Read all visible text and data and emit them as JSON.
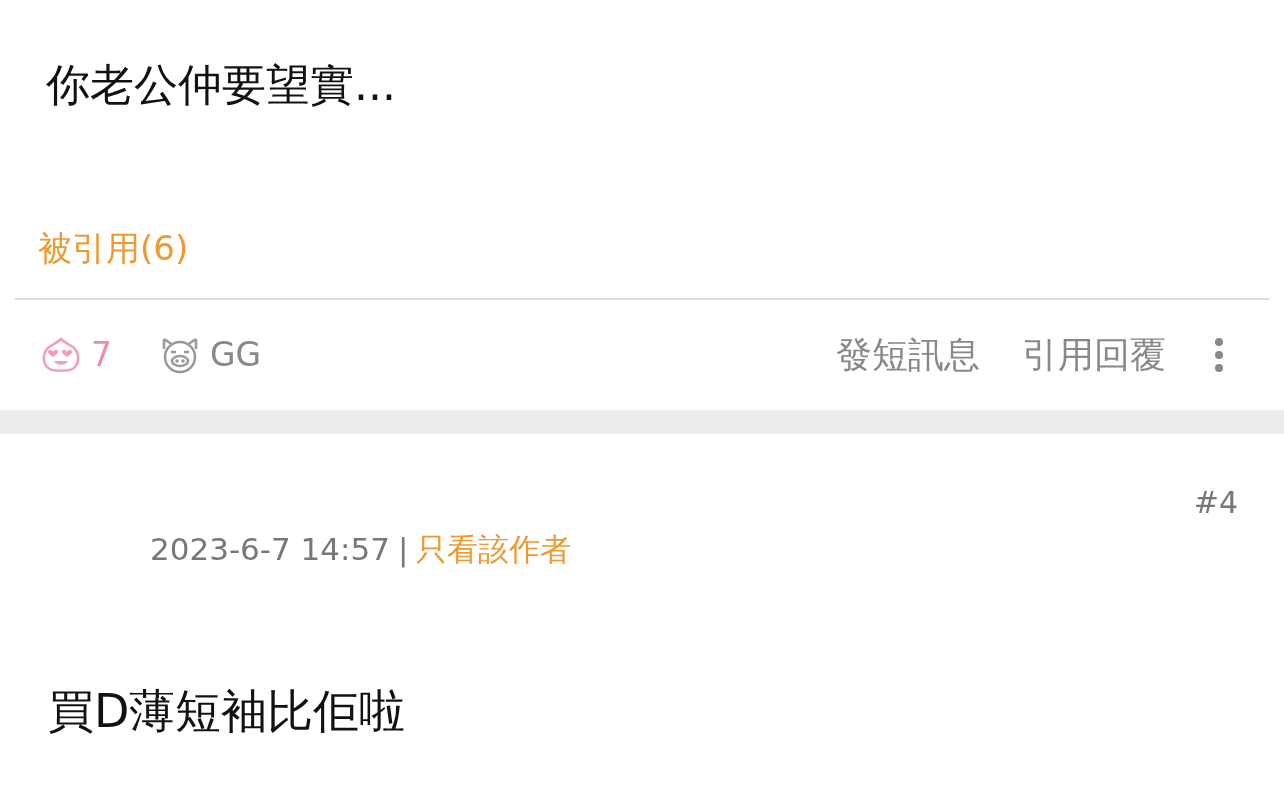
{
  "posts": [
    {
      "body": "你老公仲要望實...",
      "quoted_by": "被引用(6)",
      "likes": "7",
      "dislikes": "GG",
      "actions": [
        "發短訊息",
        "引用回覆"
      ]
    },
    {
      "floor": "#4",
      "date": "2023-6-7 14:57",
      "separator": "|",
      "author_filter": "只看該作者",
      "body": "買D薄短袖比佢啦"
    }
  ]
}
